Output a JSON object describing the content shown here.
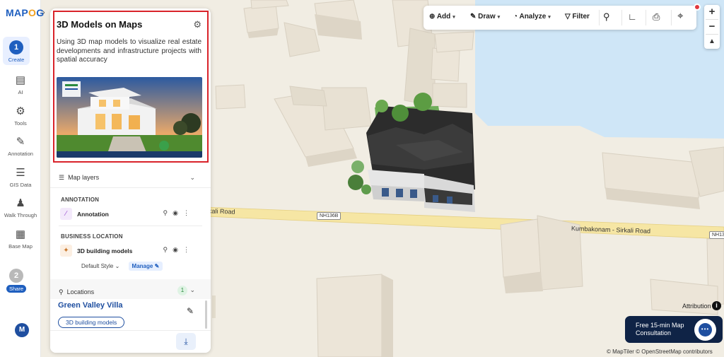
{
  "app": {
    "logo_prefix": "MAP",
    "logo_o": "O",
    "logo_suffix": "G"
  },
  "rail": {
    "create": {
      "step": "1",
      "label": "Create"
    },
    "items": [
      {
        "label": "AI"
      },
      {
        "label": "Tools"
      },
      {
        "label": "Annotation"
      },
      {
        "label": "GIS Data"
      },
      {
        "label": "Walk Through"
      },
      {
        "label": "Base Map"
      }
    ],
    "share": {
      "step": "2",
      "label": "Share"
    },
    "avatar": "M"
  },
  "card": {
    "title": "3D Models on Maps",
    "description": "Using 3D map models to visualize real estate developments and infrastructure projects with spatial accuracy"
  },
  "layers": {
    "header": "Map layers",
    "groups": [
      {
        "label": "ANNOTATION",
        "layer": "Annotation"
      },
      {
        "label": "BUSINESS LOCATION",
        "layer": "3D building models"
      }
    ],
    "style_label": "Default Style",
    "manage_label": "Manage"
  },
  "locations": {
    "header": "Locations",
    "count": "1",
    "place_name": "Green Valley Villa",
    "place_tag": "3D building models"
  },
  "toolbar": {
    "add": "Add",
    "draw": "Draw",
    "analyze": "Analyze",
    "filter": "Filter"
  },
  "map": {
    "roads": [
      {
        "label": "kali Road"
      },
      {
        "label": "Kumbakonam - Sirkali Road"
      }
    ],
    "shields": [
      "NH136B",
      "NH13"
    ],
    "attribution": "Attribution",
    "credits": "© MapTiler © OpenStreetMap contributors",
    "colors": {
      "water": "#cfe6f7",
      "road": "#f6e6a4",
      "land": "#f1ede3",
      "building_top": "#ece5d8"
    }
  },
  "cta": {
    "text": "Free 15-min Map Consultation"
  }
}
